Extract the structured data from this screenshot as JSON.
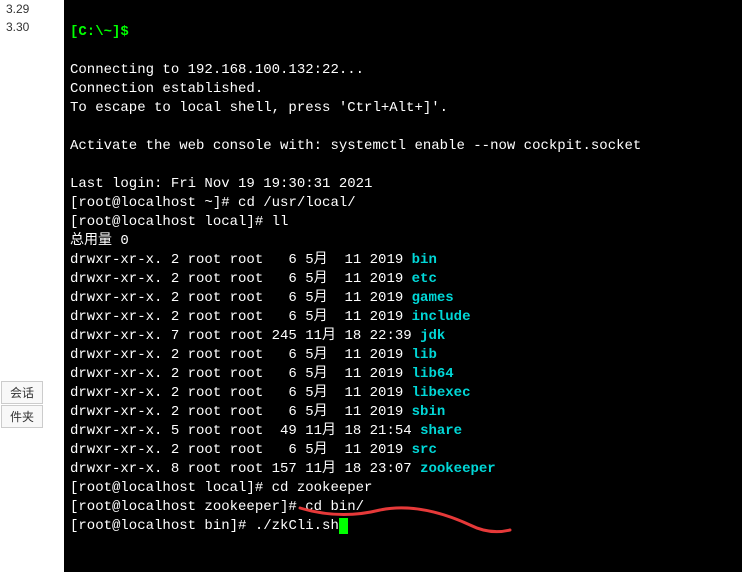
{
  "sidebar": {
    "top_items": [
      "3.29",
      "3.30"
    ],
    "middle_items": [
      "会话",
      "件夹"
    ]
  },
  "terminal": {
    "prompt_top": "[C:\\~]$",
    "connecting": "Connecting to 192.168.100.132:22...",
    "established": "Connection established.",
    "escape": "To escape to local shell, press 'Ctrl+Alt+]'.",
    "activate": "Activate the web console with: systemctl enable --now cockpit.socket",
    "last_login": "Last login: Fri Nov 19 19:30:31 2021",
    "prompt1_user": "[root@localhost ~]#",
    "cmd1": " cd /usr/local/",
    "prompt2_user": "[root@localhost local]#",
    "cmd2": " ll",
    "total": "总用量 0",
    "ls": [
      {
        "perm": "drwxr-xr-x. 2 root root   6 5月  11 2019 ",
        "name": "bin"
      },
      {
        "perm": "drwxr-xr-x. 2 root root   6 5月  11 2019 ",
        "name": "etc"
      },
      {
        "perm": "drwxr-xr-x. 2 root root   6 5月  11 2019 ",
        "name": "games"
      },
      {
        "perm": "drwxr-xr-x. 2 root root   6 5月  11 2019 ",
        "name": "include"
      },
      {
        "perm": "drwxr-xr-x. 7 root root 245 11月 18 22:39 ",
        "name": "jdk"
      },
      {
        "perm": "drwxr-xr-x. 2 root root   6 5月  11 2019 ",
        "name": "lib"
      },
      {
        "perm": "drwxr-xr-x. 2 root root   6 5月  11 2019 ",
        "name": "lib64"
      },
      {
        "perm": "drwxr-xr-x. 2 root root   6 5月  11 2019 ",
        "name": "libexec"
      },
      {
        "perm": "drwxr-xr-x. 2 root root   6 5月  11 2019 ",
        "name": "sbin"
      },
      {
        "perm": "drwxr-xr-x. 5 root root  49 11月 18 21:54 ",
        "name": "share"
      },
      {
        "perm": "drwxr-xr-x. 2 root root   6 5月  11 2019 ",
        "name": "src"
      },
      {
        "perm": "drwxr-xr-x. 8 root root 157 11月 18 23:07 ",
        "name": "zookeeper"
      }
    ],
    "prompt3_user": "[root@localhost local]#",
    "cmd3": " cd zookeeper",
    "prompt4_user": "[root@localhost zookeeper]#",
    "cmd4": " cd bin/",
    "prompt5_user": "[root@localhost bin]#",
    "cmd5": " ./zkCli.sh"
  }
}
